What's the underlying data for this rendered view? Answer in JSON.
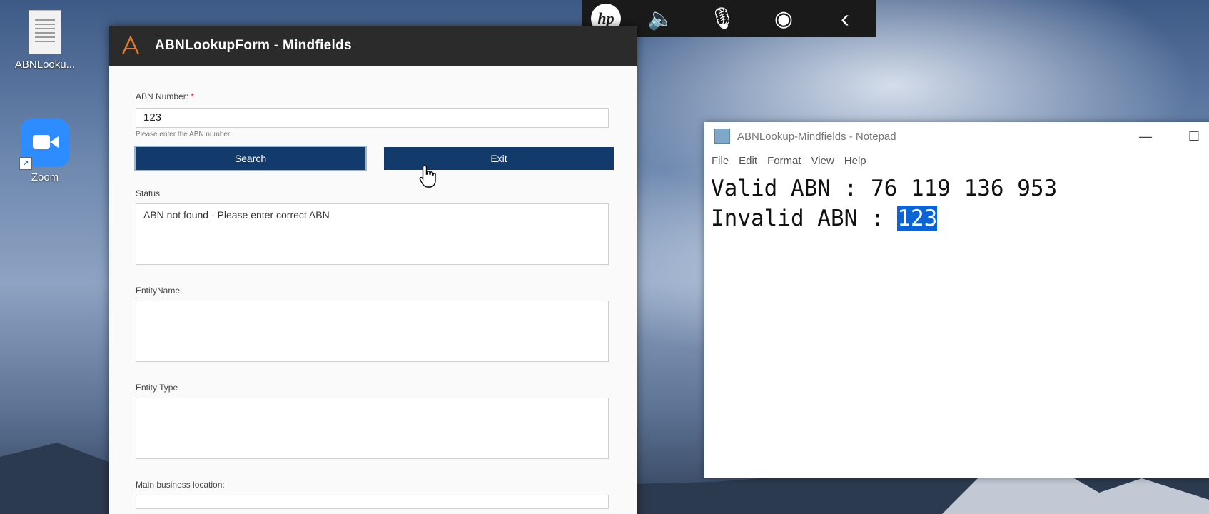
{
  "desktop": {
    "icons": [
      {
        "label": "ABNLooku..."
      },
      {
        "label": "Zoom"
      }
    ]
  },
  "form_window": {
    "title": "ABNLookupForm - Mindfields",
    "abn_label": "ABN Number:",
    "required_mark": "*",
    "abn_value": "123",
    "abn_hint": "Please enter the ABN number",
    "search_label": "Search",
    "exit_label": "Exit",
    "status_label": "Status",
    "status_value": "ABN not found - Please enter correct ABN",
    "entity_name_label": "EntityName",
    "entity_name_value": "",
    "entity_type_label": "Entity Type",
    "entity_type_value": "",
    "main_location_label": "Main business location:"
  },
  "notepad": {
    "title": "ABNLookup-Mindfields - Notepad",
    "menu": [
      "File",
      "Edit",
      "Format",
      "View",
      "Help"
    ],
    "minimize": "—",
    "maximize": "☐",
    "line1": "Valid ABN : 76 119 136 953",
    "line2_prefix": "Invalid ABN : ",
    "line2_selected": "123"
  },
  "toolbar": {
    "hp_text": "hp",
    "speaker_glyph": "🔈",
    "mic_glyph": "🎙",
    "broadcast_glyph": "◉",
    "back_glyph": "‹"
  },
  "colors": {
    "button_bg": "#123a6b",
    "title_bar": "#2b2b2b",
    "selection": "#0a64d8"
  }
}
